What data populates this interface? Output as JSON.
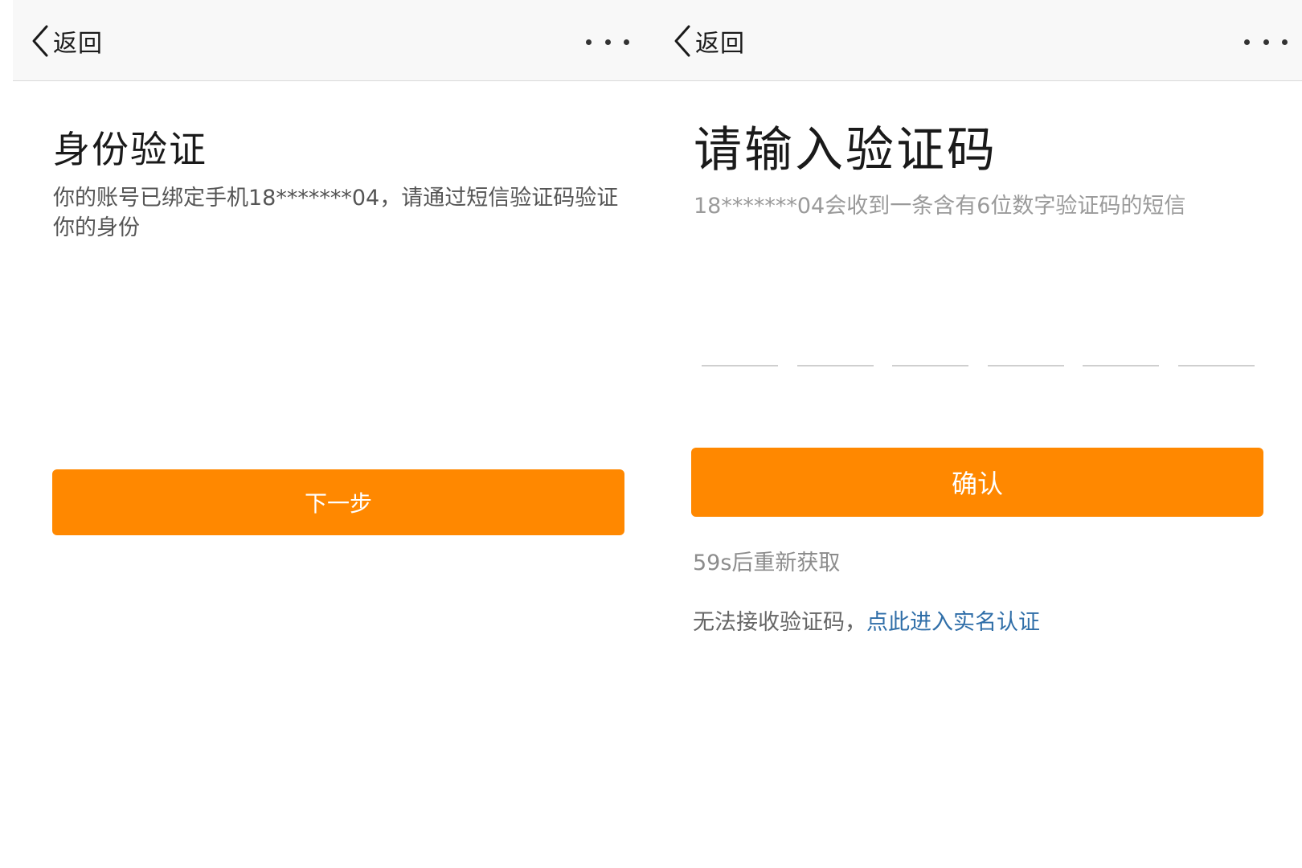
{
  "left_screen": {
    "nav": {
      "back_label": "返回",
      "back_icon": "chevron-left-icon",
      "more_icon": "more-dots-icon"
    },
    "title": "身份验证",
    "description": "你的账号已绑定手机18*******04，请通过短信验证码验证你的身份",
    "next_button": "下一步"
  },
  "right_screen": {
    "nav": {
      "back_label": "返回",
      "back_icon": "chevron-left-icon",
      "more_icon": "more-dots-icon"
    },
    "title": "请输入验证码",
    "description": "18*******04会收到一条含有6位数字验证码的短信",
    "code_cells": [
      "",
      "",
      "",
      "",
      "",
      ""
    ],
    "confirm_button": "确认",
    "resend_text": "59s后重新获取",
    "help_text": "无法接收验证码，",
    "help_link": "点此进入实名认证"
  },
  "colors": {
    "accent": "#ff8800",
    "link": "#2f6ea8",
    "nav_background": "#f8f8f8"
  }
}
